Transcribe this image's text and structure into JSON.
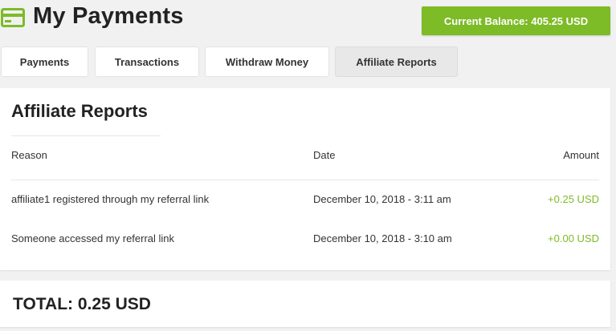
{
  "header": {
    "title": "My Payments",
    "balance_label": "Current Balance: 405.25 USD",
    "icon": "credit-card-icon",
    "accent_color": "#7dbb27"
  },
  "tabs": [
    {
      "label": "Payments",
      "active": false
    },
    {
      "label": "Transactions",
      "active": false
    },
    {
      "label": "Withdraw Money",
      "active": false
    },
    {
      "label": "Affiliate Reports",
      "active": true
    }
  ],
  "report": {
    "title": "Affiliate Reports",
    "columns": {
      "reason": "Reason",
      "date": "Date",
      "amount": "Amount"
    },
    "rows": [
      {
        "reason": "affiliate1 registered through my referral link",
        "date": "December 10, 2018 - 3:11 am",
        "amount": "+0.25 USD"
      },
      {
        "reason": "Someone accessed my referral link",
        "date": "December 10, 2018 - 3:10 am",
        "amount": "+0.00 USD"
      }
    ]
  },
  "total": {
    "label": "TOTAL: 0.25 USD"
  }
}
